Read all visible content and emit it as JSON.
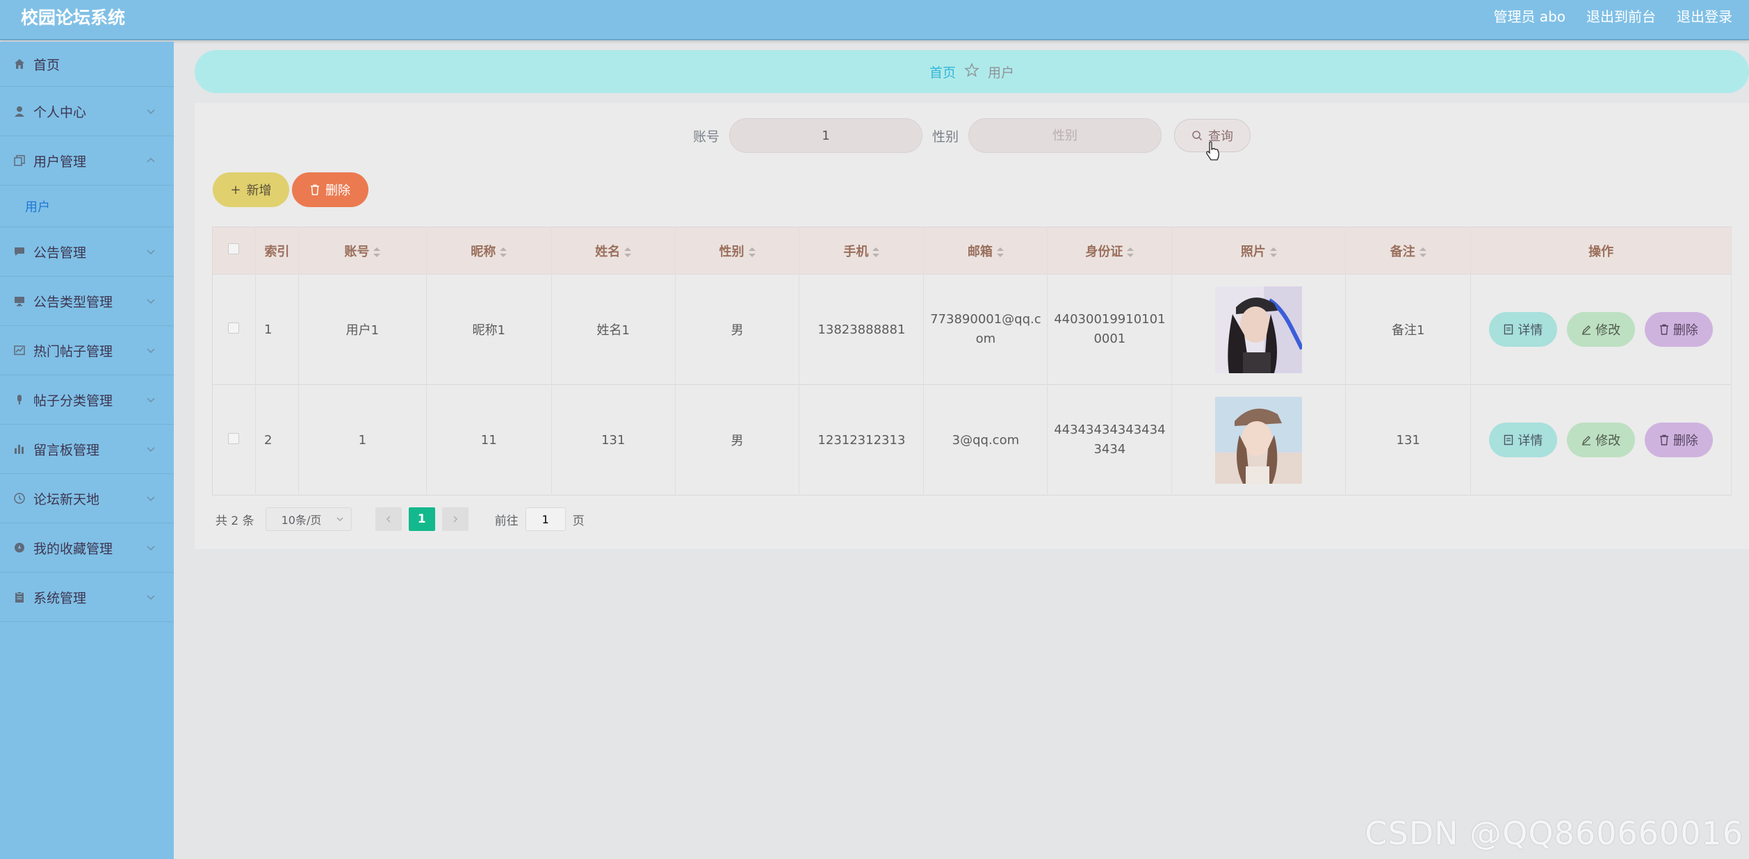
{
  "header": {
    "app_title": "校园论坛系统",
    "admin_label": "管理员 abo",
    "to_frontend": "退出到前台",
    "logout": "退出登录"
  },
  "sidebar": {
    "items": [
      {
        "label": "首页",
        "icon": "home-icon"
      },
      {
        "label": "个人中心",
        "icon": "user-icon"
      },
      {
        "label": "用户管理",
        "icon": "copy-icon",
        "expanded": true,
        "children": [
          "用户"
        ]
      },
      {
        "label": "公告管理",
        "icon": "message-icon"
      },
      {
        "label": "公告类型管理",
        "icon": "monitor-icon"
      },
      {
        "label": "热门帖子管理",
        "icon": "chart-icon"
      },
      {
        "label": "帖子分类管理",
        "icon": "microphone-icon"
      },
      {
        "label": "留言板管理",
        "icon": "bar-chart-icon"
      },
      {
        "label": "论坛新天地",
        "icon": "clock-icon"
      },
      {
        "label": "我的收藏管理",
        "icon": "compass-icon"
      },
      {
        "label": "系统管理",
        "icon": "clipboard-icon"
      }
    ]
  },
  "breadcrumb": {
    "home": "首页",
    "current": "用户"
  },
  "search": {
    "account_label": "账号",
    "account_value": "1",
    "gender_label": "性别",
    "gender_placeholder": "性别",
    "query_button": "查询"
  },
  "actions": {
    "add": "新增",
    "delete": "删除"
  },
  "table": {
    "headers": [
      "索引",
      "账号",
      "昵称",
      "姓名",
      "性别",
      "手机",
      "邮箱",
      "身份证",
      "照片",
      "备注",
      "操作"
    ],
    "rows": [
      {
        "index": "1",
        "account": "用户1",
        "nickname": "昵称1",
        "name": "姓名1",
        "gender": "男",
        "phone": "13823888881",
        "email": "773890001@qq.c\nom",
        "id_card": "44030019910101\n0001",
        "remark": "备注1"
      },
      {
        "index": "2",
        "account": "1",
        "nickname": "11",
        "name": "131",
        "gender": "男",
        "phone": "12312312313",
        "email": "3@qq.com",
        "id_card": "44343434343434\n3434",
        "remark": "131"
      }
    ],
    "op_detail": "详情",
    "op_edit": "修改",
    "op_delete": "删除"
  },
  "pagination": {
    "total": "共 2 条",
    "page_size": "10条/页",
    "current_page": "1",
    "goto_label": "前往",
    "goto_value": "1",
    "page_suffix": "页"
  },
  "watermark": "CSDN @QQ860660016",
  "colors": {
    "header": "#80c0e6",
    "breadcrumb": "#afeaea",
    "add_button": "#e0d06e",
    "delete_button": "#eb7a50",
    "page_active": "#13b98c"
  }
}
